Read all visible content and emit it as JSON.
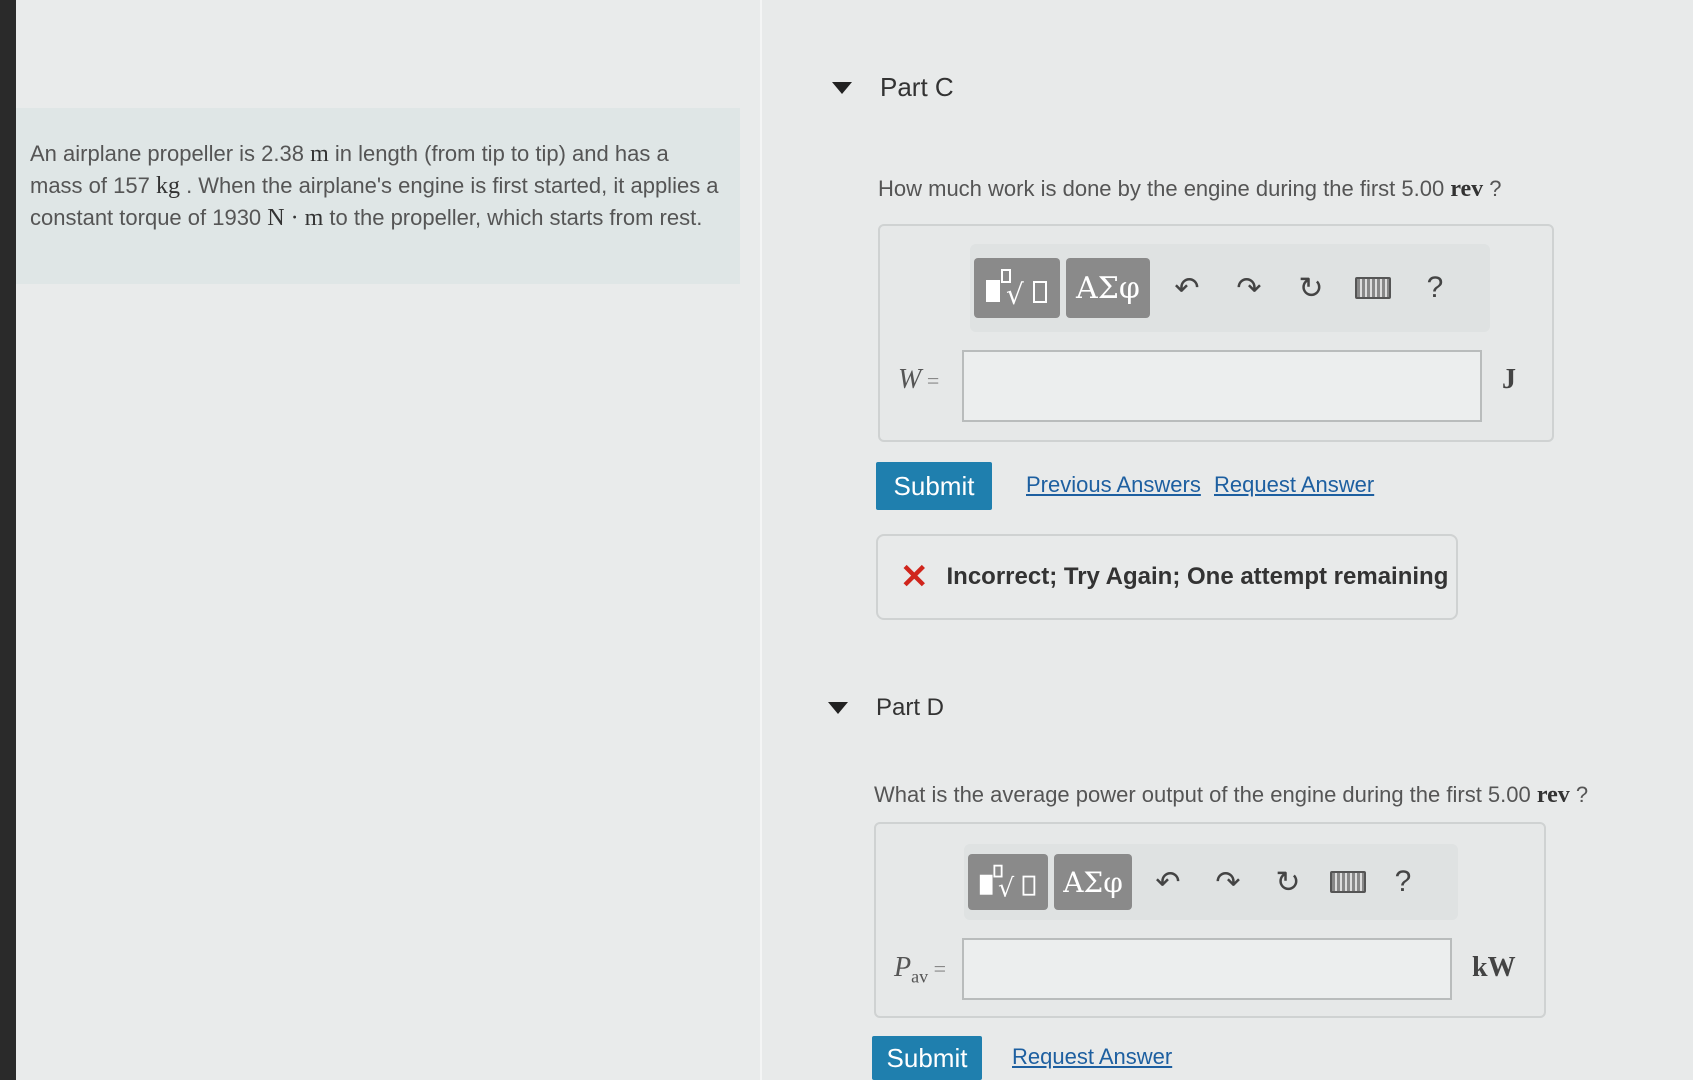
{
  "problem": {
    "t1": "An airplane propeller is 2.38 ",
    "u1": "m",
    "t2": " in length (from tip to tip) and has a mass of 157 ",
    "u2": "kg",
    "t3": " . When the airplane's engine is first started, it applies a constant torque of 1930 ",
    "u3": "N · m",
    "t4": " to the propeller, which starts from rest."
  },
  "partC": {
    "title": "Part C",
    "question_text": "How much work is done by the engine during the first 5.00 ",
    "question_unit": "rev",
    "question_end": " ?",
    "var_label": "W",
    "equals": " =",
    "unit": "J",
    "submit": "Submit",
    "previous_answers": "Previous Answers",
    "request_answer": "Request Answer",
    "feedback": "Incorrect; Try Again; One attempt remaining"
  },
  "partD": {
    "title": "Part D",
    "question_text": "What is the average power output of the engine during the first 5.00 ",
    "question_unit": "rev",
    "question_end": " ?",
    "var_label": "P",
    "var_sub": "av",
    "equals": " =",
    "unit": "kW",
    "submit": "Submit",
    "request_answer": "Request Answer"
  },
  "toolbar": {
    "greek": "ΑΣφ",
    "help": "?"
  },
  "icons": [
    "templates-icon",
    "greek-symbols-icon",
    "undo-icon",
    "redo-icon",
    "reset-icon",
    "keyboard-icon",
    "help-icon",
    "caret-down-icon",
    "incorrect-x-icon"
  ]
}
